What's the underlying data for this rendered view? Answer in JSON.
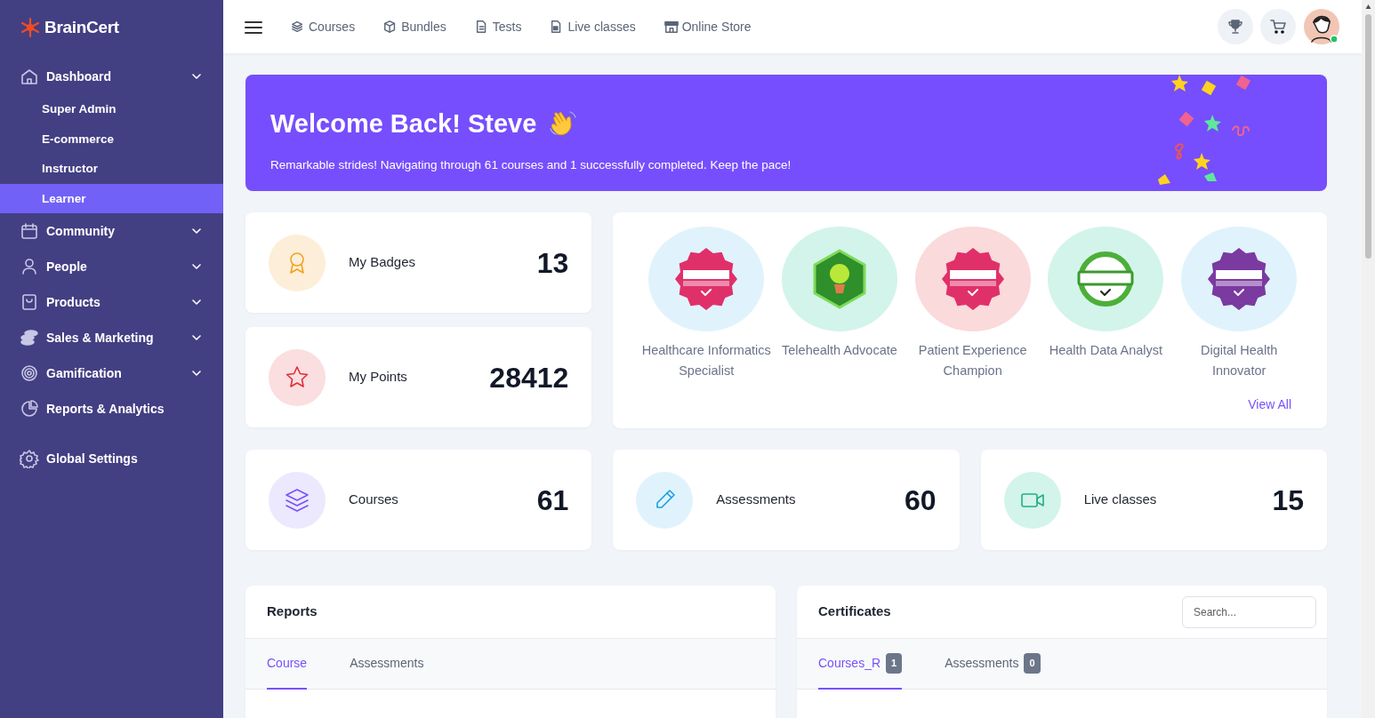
{
  "sidebar": {
    "logo": "BrainCert",
    "items": [
      {
        "label": "Dashboard",
        "kind": "home",
        "dropdown": true,
        "children": [
          {
            "label": "Super Admin",
            "selected": false
          },
          {
            "label": "E-commerce",
            "selected": false
          },
          {
            "label": "Instructor",
            "selected": false
          },
          {
            "label": "Learner",
            "selected": true
          }
        ]
      },
      {
        "label": "Community",
        "kind": "calendar",
        "dropdown": true
      },
      {
        "label": "People",
        "kind": "person",
        "dropdown": true
      },
      {
        "label": "Products",
        "kind": "bag",
        "dropdown": true
      },
      {
        "label": "Sales & Marketing",
        "kind": "coins",
        "dropdown": true
      },
      {
        "label": "Gamification",
        "kind": "target",
        "dropdown": true
      },
      {
        "label": "Reports & Analytics",
        "kind": "pie",
        "dropdown": false
      }
    ],
    "bottom_items": [
      {
        "label": "Global Settings",
        "kind": "gear",
        "dropdown": false
      }
    ]
  },
  "topbar": {
    "links": [
      {
        "label": "Courses",
        "kind": "layers"
      },
      {
        "label": "Bundles",
        "kind": "box"
      },
      {
        "label": "Tests",
        "kind": "doc"
      },
      {
        "label": "Live classes",
        "kind": "docvideo"
      },
      {
        "label": "Online Store",
        "kind": "store"
      }
    ]
  },
  "welcome": {
    "title": "Welcome Back! Steve",
    "text": "Remarkable strides! Navigating through 61 courses and 1 successfully completed. Keep the pace!"
  },
  "stats": [
    {
      "kind": "badges",
      "label": "My Badges",
      "value": "13"
    },
    {
      "kind": "points",
      "label": "My Points",
      "value": "28412"
    },
    {
      "kind": "courses",
      "label": "Courses",
      "value": "61"
    },
    {
      "kind": "assessments",
      "label": "Assessments",
      "value": "60"
    },
    {
      "kind": "live",
      "label": "Live classes",
      "value": "15"
    }
  ],
  "badges": {
    "items": [
      {
        "name": "Healthcare Informatics Specialist",
        "color": "#e0f3fd",
        "kind": "seal-pink"
      },
      {
        "name": "Telehealth Advocate",
        "color": "#d3f4ea",
        "kind": "hexagon"
      },
      {
        "name": "Patient Experience Champion",
        "color": "#fadadb",
        "kind": "seal-pink"
      },
      {
        "name": "Health Data Analyst",
        "color": "#d3f4ea",
        "kind": "ribbon"
      },
      {
        "name": "Digital Health Innovator",
        "color": "#e0f3fd",
        "kind": "seal-purple"
      }
    ],
    "view_all": "View All"
  },
  "reports": {
    "title": "Reports",
    "tabs": [
      {
        "label": "Course",
        "selected": true
      },
      {
        "label": "Assessments",
        "selected": false
      }
    ]
  },
  "certificates": {
    "title": "Certificates",
    "search": {
      "placeholder": "Search..."
    },
    "tabs": [
      {
        "label": "Courses_R",
        "count": "1",
        "selected": true
      },
      {
        "label": "Assessments",
        "count": "0",
        "selected": false
      }
    ]
  }
}
